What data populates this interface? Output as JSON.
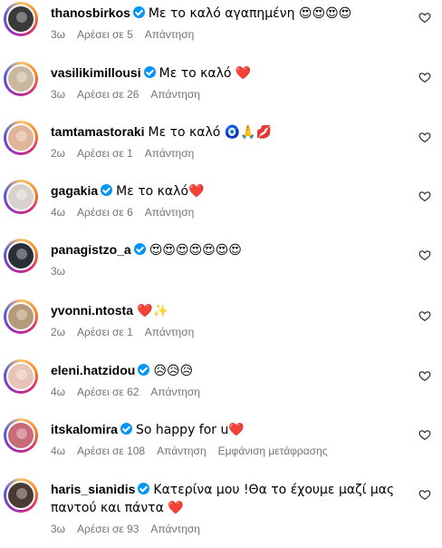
{
  "comments": [
    {
      "avatar_color": "#3a3a3a",
      "username": "thanosbirkos",
      "verified": true,
      "text": "Με το καλό αγαπημένη 😍😍😍😍",
      "time": "3ω",
      "likes": "Αρέσει σε 5",
      "reply": "Απάντηση",
      "translate": ""
    },
    {
      "avatar_color": "#c9b7a0",
      "username": "vasilikimillousi",
      "verified": true,
      "text": "Με το καλό ❤️",
      "time": "3ω",
      "likes": "Αρέσει σε 26",
      "reply": "Απάντηση",
      "translate": ""
    },
    {
      "avatar_color": "#e0b49a",
      "username": "tamtamastoraki",
      "verified": false,
      "text": "Με το καλό 🧿🙏💋",
      "time": "2ω",
      "likes": "Αρέσει σε 1",
      "reply": "Απάντηση",
      "translate": ""
    },
    {
      "avatar_color": "#d8d2cc",
      "username": "gagakia",
      "verified": true,
      "text": "Με το καλό❤️",
      "time": "4ω",
      "likes": "Αρέσει σε 6",
      "reply": "Απάντηση",
      "translate": ""
    },
    {
      "avatar_color": "#2c2f38",
      "username": "panagistzo_a",
      "verified": true,
      "text": "😍😍😍😍😍😍😍",
      "time": "3ω",
      "likes": "",
      "reply": "",
      "translate": ""
    },
    {
      "avatar_color": "#b59a7a",
      "username": "yvonni.ntosta",
      "verified": false,
      "text": "❤️✨",
      "time": "2ω",
      "likes": "Αρέσει σε 1",
      "reply": "Απάντηση",
      "translate": ""
    },
    {
      "avatar_color": "#e7c3b8",
      "username": "eleni.hatzidou",
      "verified": true,
      "text": "😥😥😥",
      "time": "4ω",
      "likes": "Αρέσει σε 62",
      "reply": "Απάντηση",
      "translate": ""
    },
    {
      "avatar_color": "#c86a7a",
      "username": "itskalomira",
      "verified": true,
      "text": "So happy for u❤️",
      "time": "4ω",
      "likes": "Αρέσει σε 108",
      "reply": "Απάντηση",
      "translate": "Εμφάνιση μετάφρασης"
    },
    {
      "avatar_color": "#4a3a33",
      "username": "haris_sianidis",
      "verified": true,
      "text": "Κατερίνα μου !Θα το έχουμε μαζί μας παντού και πάντα ❤️",
      "time": "3ω",
      "likes": "Αρέσει σε 93",
      "reply": "Απάντηση",
      "translate": ""
    }
  ],
  "heart_icon": "heart-outline-icon",
  "accent": "#0095f6"
}
